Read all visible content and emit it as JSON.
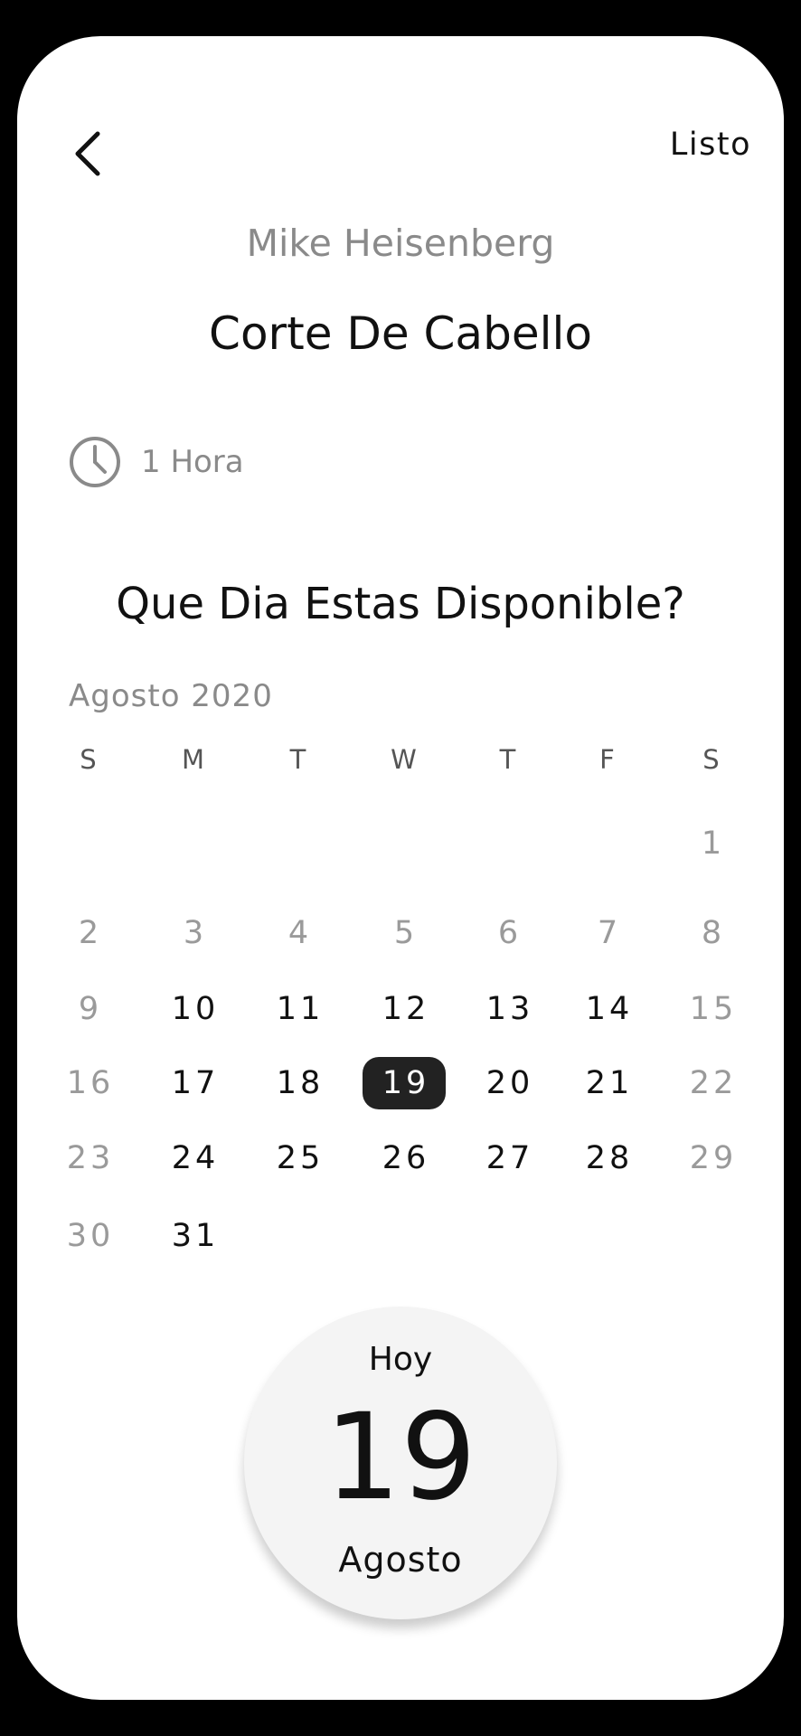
{
  "header": {
    "back_icon": "chevron-left-icon",
    "done_label": "Listo"
  },
  "booking": {
    "provider_name": "Mike Heisenberg",
    "service_title": "Corte De Cabello",
    "duration_icon": "clock-icon",
    "duration": "1 Hora"
  },
  "calendar": {
    "question": "Que Dia Estas Disponible?",
    "month_label": "Agosto 2020",
    "weekdays": [
      "S",
      "M",
      "T",
      "W",
      "T",
      "F",
      "S"
    ],
    "weeks": [
      [
        null,
        null,
        null,
        null,
        null,
        null,
        "1"
      ],
      [
        "2",
        "3",
        "4",
        "5",
        "6",
        "7",
        "8"
      ],
      [
        "9",
        "10",
        "11",
        "12",
        "13",
        "14",
        "15"
      ],
      [
        "16",
        "17",
        "18",
        "19",
        "20",
        "21",
        "22"
      ],
      [
        "23",
        "24",
        "25",
        "26",
        "27",
        "28",
        "29"
      ],
      [
        "30",
        "31",
        null,
        null,
        null,
        null,
        null
      ]
    ],
    "available_days": [
      "10",
      "11",
      "12",
      "13",
      "14",
      "17",
      "18",
      "19",
      "20",
      "21",
      "24",
      "25",
      "26",
      "27",
      "28",
      "31"
    ],
    "selected_day": "19"
  },
  "today": {
    "label": "Hoy",
    "day": "19",
    "month": "Agosto"
  },
  "colors": {
    "selected_bg": "#222222",
    "muted_text": "#8a8a8a",
    "today_bg": "#f4f4f4"
  }
}
